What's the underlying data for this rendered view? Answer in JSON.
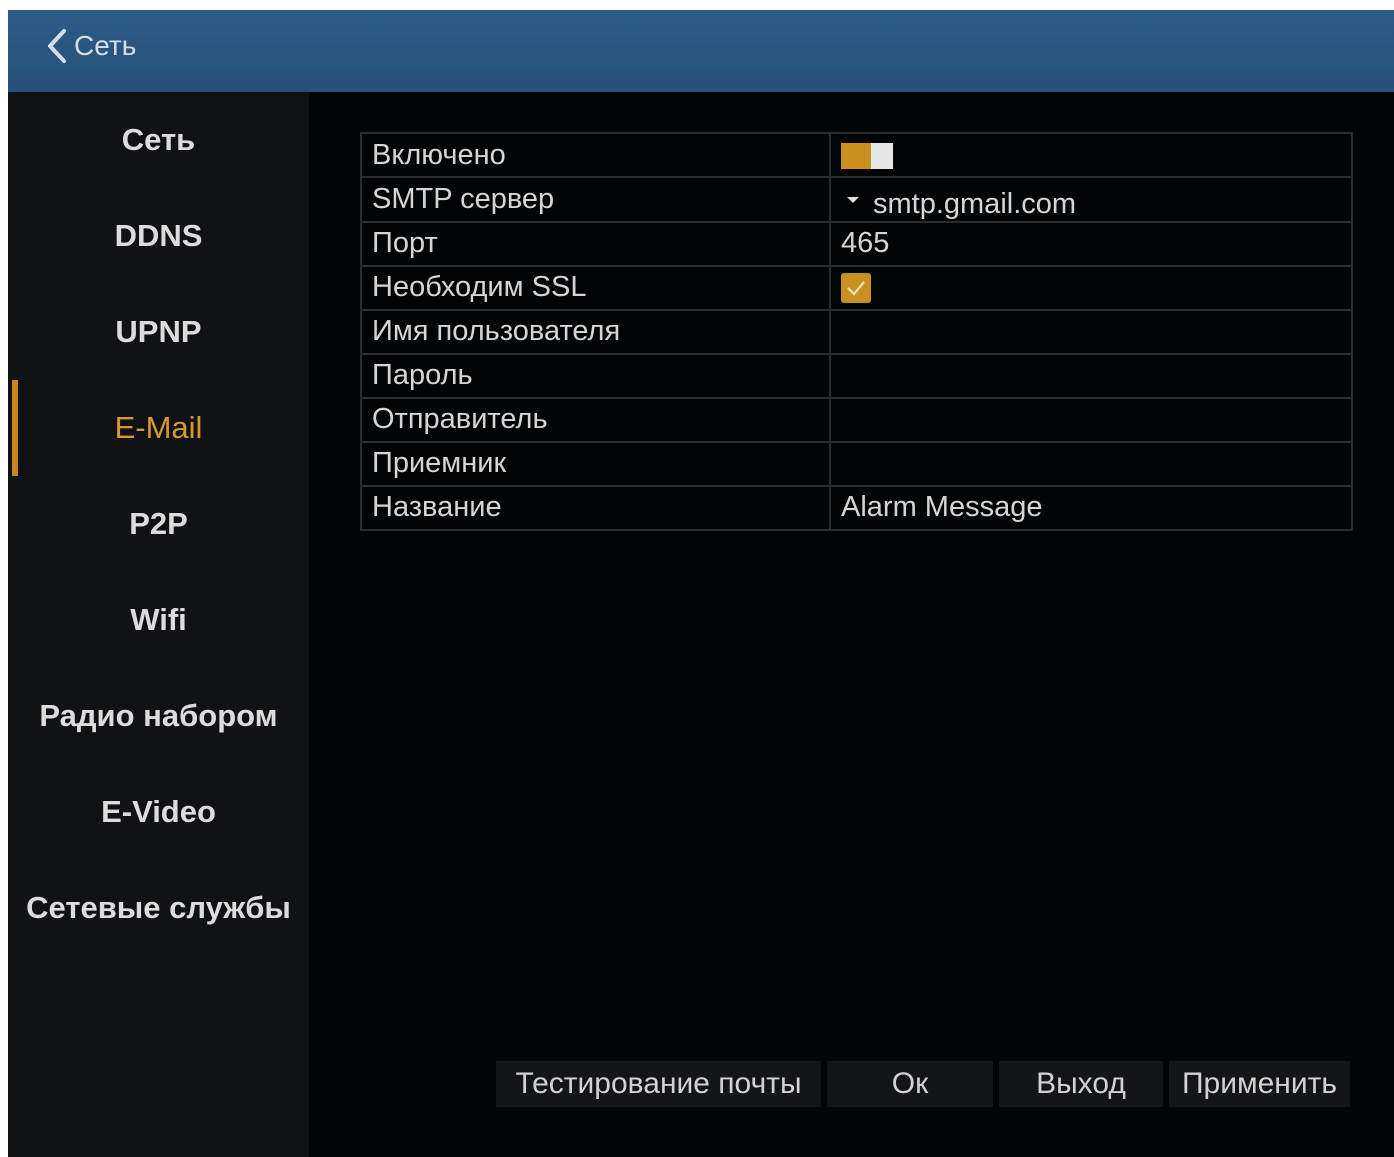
{
  "header": {
    "back_label": "Сеть"
  },
  "sidebar": {
    "items": [
      {
        "label": "Сеть"
      },
      {
        "label": "DDNS"
      },
      {
        "label": "UPNP"
      },
      {
        "label": "E-Mail",
        "active": true
      },
      {
        "label": "P2P"
      },
      {
        "label": "Wifi"
      },
      {
        "label": "Радио набором"
      },
      {
        "label": "E-Video"
      },
      {
        "label": "Сетевые службы"
      }
    ]
  },
  "email_settings": {
    "enabled": {
      "label": "Включено",
      "value": true
    },
    "smtp_server": {
      "label": "SMTP сервер",
      "value": "smtp.gmail.com"
    },
    "port": {
      "label": "Порт",
      "value": "465"
    },
    "ssl": {
      "label": "Необходим SSL",
      "value": true
    },
    "username": {
      "label": "Имя пользователя",
      "value": ""
    },
    "password": {
      "label": "Пароль",
      "value": ""
    },
    "sender": {
      "label": "Отправитель",
      "value": ""
    },
    "receiver": {
      "label": "Приемник",
      "value": ""
    },
    "subject": {
      "label": "Название",
      "value": "Alarm Message"
    }
  },
  "buttons": {
    "test_mail": "Тестирование почты",
    "ok": "Ок",
    "exit": "Выход",
    "apply": "Применить"
  },
  "colors": {
    "titlebar": "#2b5d8a",
    "accent": "#c9901f",
    "active_text": "#d79a2a"
  },
  "icons": {
    "back": "chevron-left-icon",
    "dropdown": "caret-down-icon",
    "checkbox": "checkmark-icon"
  }
}
